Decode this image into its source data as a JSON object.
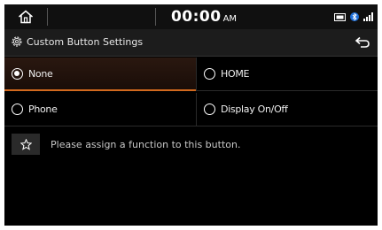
{
  "status": {
    "time": "00:00",
    "ampm": "AM",
    "icons": [
      "home-icon",
      "media-icon",
      "bluetooth-phone-icon",
      "signal-icon"
    ]
  },
  "header": {
    "title": "Custom Button Settings",
    "icon": "gear-icon",
    "back_icon": "back-icon"
  },
  "options": [
    {
      "label": "None",
      "selected": true
    },
    {
      "label": "HOME",
      "selected": false
    },
    {
      "label": "Phone",
      "selected": false
    },
    {
      "label": "Display On/Off",
      "selected": false
    }
  ],
  "hint": {
    "icon": "star-icon",
    "text": "Please assign a function to this button."
  },
  "colors": {
    "accent": "#d2691e",
    "background": "#000000"
  }
}
